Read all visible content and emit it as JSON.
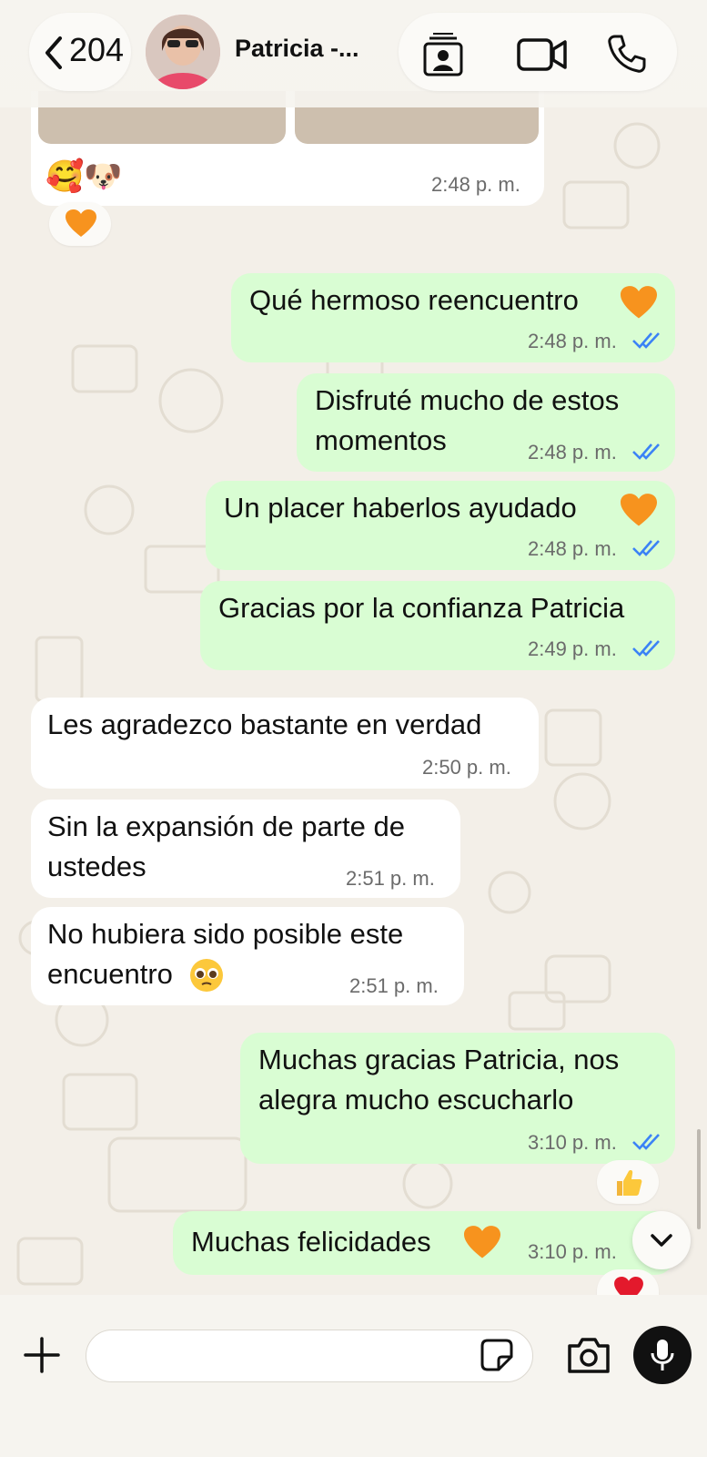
{
  "header": {
    "back_count": "204",
    "contact_name": "Patricia -...",
    "icons": [
      "chevron-left-icon",
      "contact-card-icon",
      "video-call-icon",
      "phone-icon"
    ]
  },
  "prev_message": {
    "emojis": "🥰🐶",
    "time": "2:48 p. m.",
    "reaction": "🧡"
  },
  "messages": [
    {
      "direction": "out",
      "text": "Qué hermoso reencuentro",
      "emoji": "🧡",
      "time": "2:48 p. m.",
      "read": true
    },
    {
      "direction": "out",
      "lines": [
        "Disfruté mucho de estos",
        "momentos"
      ],
      "time": "2:48 p. m.",
      "read": true
    },
    {
      "direction": "out",
      "text": "Un placer haberlos ayudado",
      "emoji": "🧡",
      "time": "2:48 p. m.",
      "read": true
    },
    {
      "direction": "out",
      "text": "Gracias por la confianza Patricia",
      "time": "2:49 p. m.",
      "read": true
    },
    {
      "direction": "in",
      "text": "Les agradezco bastante en verdad",
      "time": "2:50 p. m."
    },
    {
      "direction": "in",
      "lines": [
        "Sin la expansión de parte de",
        "ustedes"
      ],
      "time": "2:51 p. m."
    },
    {
      "direction": "in",
      "lines": [
        "No hubiera sido posible este",
        "encuentro"
      ],
      "emoji": "🥹",
      "time": "2:51 p. m."
    },
    {
      "direction": "out",
      "lines": [
        "Muchas gracias Patricia, nos",
        "alegra mucho escucharlo"
      ],
      "time": "3:10 p. m.",
      "read": true,
      "reaction": "👍"
    },
    {
      "direction": "out",
      "text": "Muchas felicidades",
      "emoji": "🧡",
      "time": "3:10 p. m.",
      "read": true,
      "reaction": "❤️"
    }
  ],
  "input": {
    "placeholder": "",
    "icons": [
      "plus-icon",
      "sticker-icon",
      "camera-icon",
      "microphone-icon"
    ]
  },
  "colors": {
    "outgoing_bubble": "#d9fdd3",
    "incoming_bubble": "#ffffff",
    "read_ticks": "#3b82f6",
    "background": "#f3efe8"
  }
}
